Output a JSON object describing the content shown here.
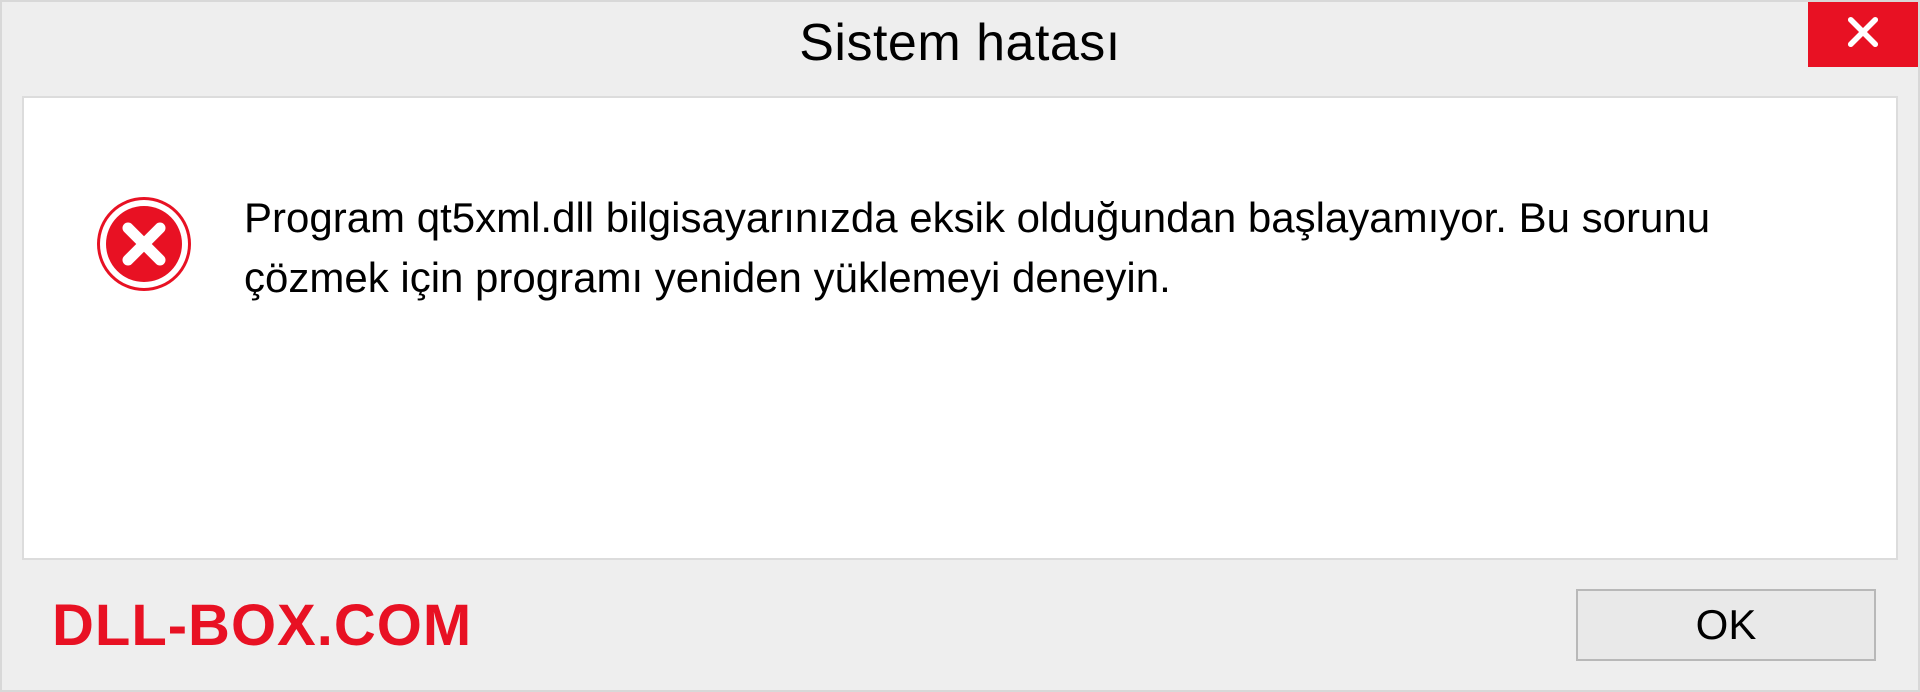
{
  "titlebar": {
    "title": "Sistem hatası"
  },
  "content": {
    "message": "Program qt5xml.dll bilgisayarınızda eksik olduğundan başlayamıyor. Bu sorunu çözmek için programı yeniden yüklemeyi deneyin."
  },
  "footer": {
    "watermark": "DLL-BOX.COM",
    "ok_label": "OK"
  },
  "colors": {
    "error_red": "#e81123",
    "panel_bg": "#eeeeee",
    "content_bg": "#ffffff"
  }
}
